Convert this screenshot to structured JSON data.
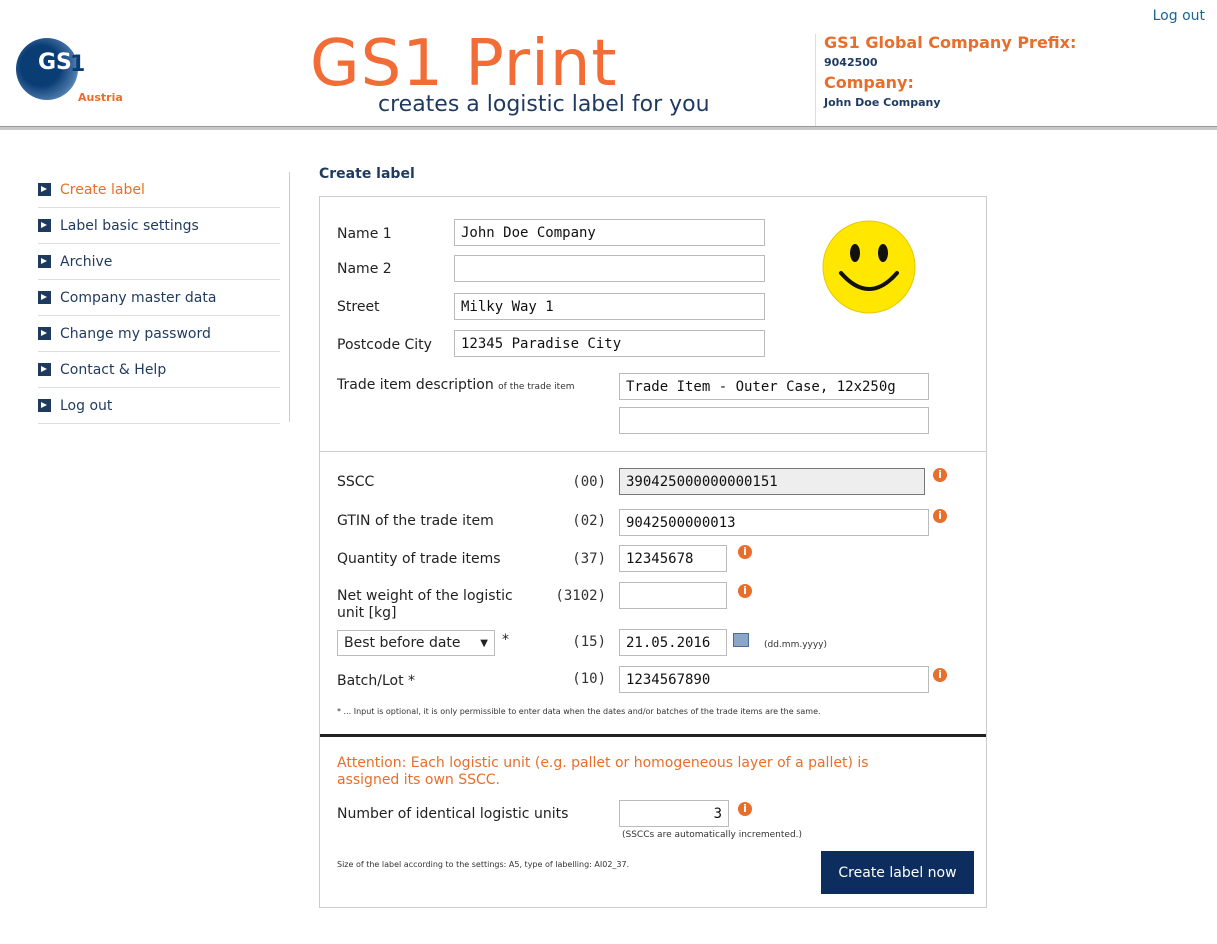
{
  "header": {
    "logout_label": "Log out",
    "logo": {
      "gs": "GS",
      "one": "1",
      "country": "Austria"
    },
    "title": "GS1 Print",
    "subtitle": "creates a logistic label for you",
    "prefix_label": "GS1 Global Company Prefix:",
    "prefix_value": "9042500",
    "company_label": "Company:",
    "company_value": "John Doe Company"
  },
  "sidebar": {
    "items": [
      {
        "label": "Create label",
        "active": true
      },
      {
        "label": "Label basic settings"
      },
      {
        "label": "Archive"
      },
      {
        "label": "Company master data"
      },
      {
        "label": "Change my password"
      },
      {
        "label": "Contact & Help"
      },
      {
        "label": "Log out"
      }
    ]
  },
  "main": {
    "page_title": "Create label",
    "address": {
      "name1_label": "Name 1",
      "name1_value": "John Doe Company",
      "name2_label": "Name 2",
      "name2_value": "",
      "street_label": "Street",
      "street_value": "Milky Way 1",
      "postcode_label": "Postcode City",
      "postcode_value": "12345 Paradise City",
      "desc_label": "Trade item description",
      "desc_sub": "of the trade item",
      "desc_value1": "Trade Item - Outer Case, 12x250g",
      "desc_value2": ""
    },
    "fields": {
      "sscc_label": "SSCC",
      "sscc_ai": "(00)",
      "sscc_value": "390425000000000151",
      "gtin_label": "GTIN of the trade item",
      "gtin_ai": "(02)",
      "gtin_value": "9042500000013",
      "qty_label": "Quantity of trade items",
      "qty_ai": "(37)",
      "qty_value": "12345678",
      "net_label_1": "Net weight of the logistic",
      "net_label_2": "unit [kg]",
      "net_ai": "(3102)",
      "net_value": "",
      "date_select": "Best before date",
      "date_star": "*",
      "date_ai": "(15)",
      "date_value": "21.05.2016",
      "date_format": "(dd.mm.yyyy)",
      "batch_label": "Batch/Lot",
      "batch_star": "*",
      "batch_ai": "(10)",
      "batch_value": "1234567890",
      "note": "* ... Input is optional, it is only permissible to enter data when the dates and/or batches of the trade items are the same."
    },
    "units": {
      "attention_1": "Attention: Each logistic unit (e.g. pallet or homogeneous layer of a pallet) is",
      "attention_2": "assigned its own SSCC.",
      "count_label": "Number of identical logistic units",
      "count_value": "3",
      "count_note": "(SSCCs are automatically incremented.)",
      "size_note": "Size of the label according to the settings: A5, type of labelling: AI02_37.",
      "submit_label": "Create label now"
    },
    "info_glyph": "i"
  },
  "colors": {
    "accent": "#f26c35",
    "navy": "#1f3a5f",
    "button": "#0d2d5e",
    "smiley": "#ffe700"
  }
}
